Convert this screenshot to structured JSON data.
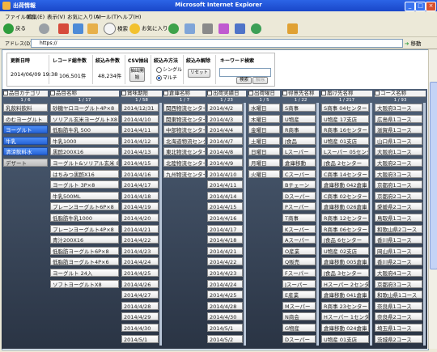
{
  "window": {
    "title": "Microsoft Internet Explorer",
    "app": "出荷情報"
  },
  "menu": [
    "ファイル(F)",
    "編集(E)",
    "表示(V)",
    "お気に入り(A)",
    "ツール(T)",
    "ヘルプ(H)"
  ],
  "toolbar": {
    "back": "戻る",
    "search": "検索",
    "favorites": "お気に入り"
  },
  "address": {
    "label": "アドレス(D)",
    "url": "https://",
    "go": "移動"
  },
  "stats": {
    "headers": {
      "updated": "更新日時",
      "total": "レコード総件数",
      "narrowed": "絞込み件数",
      "csv": "CSV抽出",
      "method": "絞込み方法",
      "clear": "絞込み解除",
      "keyword": "キーワード検索"
    },
    "values": {
      "updated": "2014/06/09 19:38",
      "total": "106,501件",
      "narrowed": "48,234件"
    },
    "csv_button": "抽出開始",
    "method_single": "シングル",
    "method_multi": "マルチ",
    "reset_button": "リセット",
    "search_button": "検索",
    "cancel_button": "解除"
  },
  "columns": [
    {
      "title": "品目カテゴリ",
      "count": "1 / 6",
      "items": [
        "乳飲料飲料",
        "のむヨーグルト",
        "ヨーグルト",
        "牛乳",
        "清涼飲料水",
        "デザート"
      ]
    },
    {
      "title": "品目名称",
      "count": "1 / 17",
      "items": [
        "砂糖ヤロヨーグルト4P×8",
        "ソリアル玄米ヨーグルトX8",
        "低脂肪牛乳 500",
        "牛乳1000",
        "黒酢200X16",
        "ヨーグルト&ソリアル玄米 8入",
        "はちみつ黒酢X16",
        "ヨーグルト 3P×8",
        "牛乳500ML",
        "プレーンヨーグルト6P×8",
        "低脂肪牛乳1000",
        "プレーンヨーグルト4P×8",
        "青汁200X16",
        "低脂肪ヨーグルト6P×8",
        "低脂肪ヨーグルト4P×6",
        "ヨーグルト 24入",
        "ソフトヨーグルトX8"
      ]
    },
    {
      "title": "賞味期限",
      "count": "1 / 58",
      "items": [
        "2014/12/31",
        "2014/4/10",
        "2014/4/11",
        "2014/4/12",
        "2014/4/13",
        "2014/4/15",
        "2014/4/16",
        "2014/4/17",
        "2014/4/18",
        "2014/4/19",
        "2014/4/20",
        "2014/4/21",
        "2014/4/22",
        "2014/4/23",
        "2014/4/24",
        "2014/4/25",
        "2014/4/26",
        "2014/4/27",
        "2014/4/28",
        "2014/4/29",
        "2014/4/30",
        "2014/5/1"
      ]
    },
    {
      "title": "倉庫名称",
      "count": "1 / 7",
      "items": [
        "関西物流センター",
        "関東物流センター",
        "中部物流センター",
        "北海道物流センター",
        "東北物流センター",
        "北陸物流センター",
        "九州物流センター"
      ]
    },
    {
      "title": "出荷実績日",
      "count": "1 / 23",
      "items": [
        "2014/4/2",
        "2014/4/3",
        "2014/4/4",
        "2014/4/7",
        "2014/4/8",
        "2014/4/9",
        "2014/4/10",
        "2014/4/11",
        "2014/4/14",
        "2014/4/15",
        "2014/4/16",
        "2014/4/17",
        "2014/4/18",
        "2014/4/21",
        "2014/4/22",
        "2014/4/23",
        "2014/4/24",
        "2014/4/25",
        "2014/4/28",
        "2014/4/30",
        "2014/5/1",
        "2014/5/2"
      ]
    },
    {
      "title": "出荷曜日",
      "count": "1 / 5",
      "items": [
        "水曜日",
        "木曜日",
        "金曜日",
        "土曜日",
        "日曜日",
        "月曜日",
        "火曜日"
      ]
    },
    {
      "title": "得意先名称",
      "count": "1 / 22",
      "items": [
        "S商事",
        "U物産",
        "R商事",
        "J食品",
        "Lスーパー",
        "倉庫移動",
        "Cスーパー",
        "Bチェーン",
        "Dスーパー",
        "Pスーパー",
        "T商事",
        "Kスーパー",
        "Aスーパー",
        "O産業",
        "Q販売",
        "Fスーパー",
        "Jスーパー",
        "E産業",
        "Mスーパー",
        "N商会",
        "G物産",
        "Dスーパー"
      ]
    },
    {
      "title": "届け先名称",
      "count": "1 / 217",
      "items": [
        "S商事 04センター",
        "U物産 17支店",
        "R商事 16センター",
        "U物産 01支店",
        "Lスーパー 05センター",
        "J食品 2センター",
        "C商事 14センター",
        "倉庫移動 042倉庫",
        "C商事 02センター",
        "倉庫移動 026倉庫",
        "R商事 12センター",
        "R商事 06センター",
        "J食品 6センター",
        "U物産 02支店",
        "倉庫移動 005倉庫",
        "J食品 3センター",
        "Hスーパー 2センター",
        "倉庫移動 041倉庫",
        "R商事 23センター",
        "Hスーパー 1センター",
        "倉庫移動 024倉庫",
        "U物産 01支店"
      ]
    },
    {
      "title": "コース名称",
      "count": "1 / 93",
      "items": [
        "大阪府3コース",
        "広島県1コース",
        "滋賀県1コース",
        "山口県1コース",
        "大阪府1コース",
        "大阪府2コース",
        "大阪府3コース",
        "京都府1コース",
        "京都府2コース",
        "愛媛県2コース",
        "鳥取県1コース",
        "和歌山県2コース",
        "香川県1コース",
        "岡山県1コース",
        "香川県2コース",
        "大阪府4コース",
        "京都府3コース",
        "和歌山県1コース",
        "奈良県1コース",
        "奈良県2コース",
        "埼玉県1コース",
        "茨城県2コース"
      ]
    }
  ],
  "colors": {
    "selected": "#2f6fdf",
    "titlebar": "#2456d6",
    "panel": "#3b4759"
  }
}
